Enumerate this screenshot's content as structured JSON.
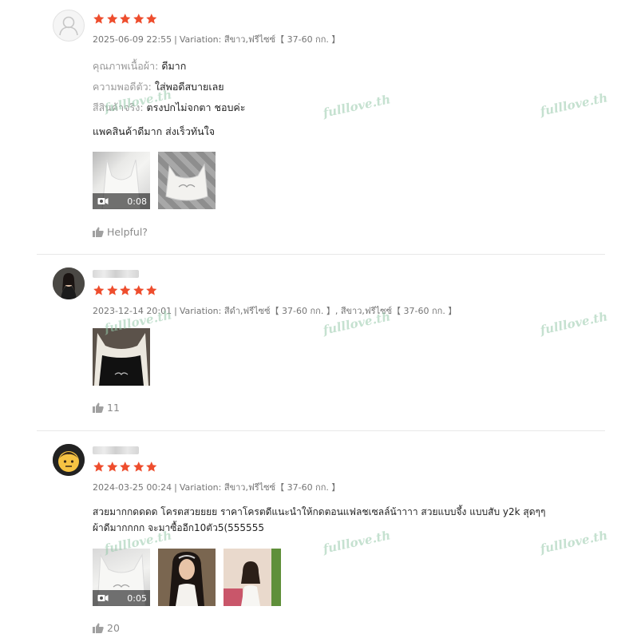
{
  "reviews": [
    {
      "rating": 5,
      "datetime": "2025-06-09 22:55",
      "variation_label": "Variation:",
      "variation_value": "สีขาว,ฟรีไซซ์【 37-60 กก. 】",
      "attributes": [
        {
          "label": "คุณภาพเนื้อผ้า:",
          "value": "ดีมาก"
        },
        {
          "label": "ความพอดีตัว:",
          "value": "ใส่พอดีสบายเลย"
        },
        {
          "label": "สีสินค้าจริง:",
          "value": "ตรงปกไม่จกตา ชอบค่ะ"
        }
      ],
      "comment": "แพคสินค้าดีมาก ส่งเร็วทันใจ",
      "video_duration": "0:08",
      "like_label": "Helpful?"
    },
    {
      "rating": 5,
      "datetime": "2023-12-14 20:01",
      "variation_label": "Variation:",
      "variation_value": "สีดำ,ฟรีไซซ์【 37-60 กก. 】, สีขาว,ฟรีไซซ์【 37-60 กก. 】",
      "like_count": "11"
    },
    {
      "rating": 5,
      "datetime": "2024-03-25 00:24",
      "variation_label": "Variation:",
      "variation_value": "สีขาว,ฟรีไซซ์【 37-60 กก. 】",
      "comment_line1": "สวยมากกดดดด โครตสวยยยย ราคาโครตดีแนะนำให้กดตอนแฟลชเซลล์น้าาาา สวยแบบจึ้ง แบบสับ y2k สุดๆๆ",
      "comment_line2": "ผ้าดีมากกกก  จะมาซื้ออีก10ตัว5(555555",
      "video_duration": "0:05",
      "like_count": "20"
    }
  ],
  "watermark_text": "fulllove.th",
  "colors": {
    "star": "#ee4d2d",
    "meta": "#757575",
    "divider": "#e8e8e8"
  }
}
